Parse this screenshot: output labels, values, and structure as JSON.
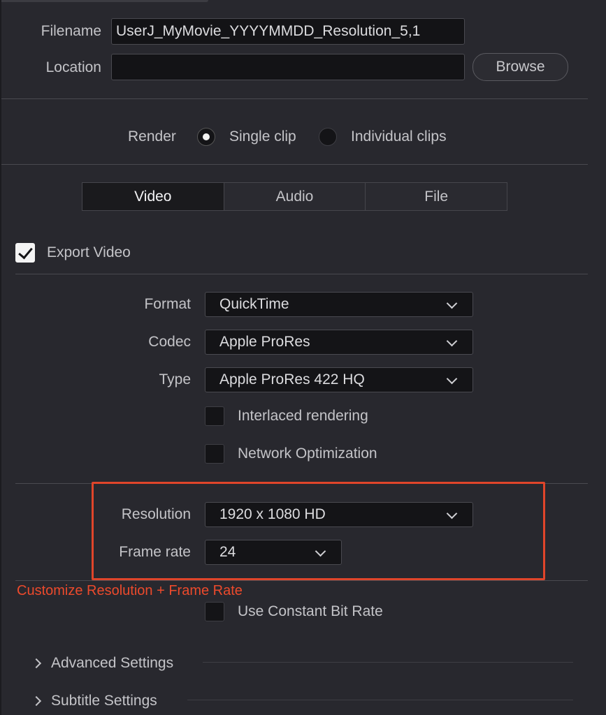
{
  "file": {
    "filename_label": "Filename",
    "filename_value": "UserJ_MyMovie_YYYYMMDD_Resolution_5,1",
    "location_label": "Location",
    "location_value": "",
    "browse_label": "Browse"
  },
  "render": {
    "label": "Render",
    "single_clip": "Single clip",
    "individual_clips": "Individual clips",
    "selected": "single_clip"
  },
  "tabs": [
    {
      "label": "Video",
      "active": true
    },
    {
      "label": "Audio",
      "active": false
    },
    {
      "label": "File",
      "active": false
    }
  ],
  "video": {
    "export_video_label": "Export Video",
    "export_video_checked": true,
    "format_label": "Format",
    "format_value": "QuickTime",
    "codec_label": "Codec",
    "codec_value": "Apple ProRes",
    "type_label": "Type",
    "type_value": "Apple ProRes 422 HQ",
    "interlaced_label": "Interlaced rendering",
    "interlaced_checked": false,
    "network_label": "Network Optimization",
    "network_checked": false,
    "resolution_label": "Resolution",
    "resolution_value": "1920 x 1080 HD",
    "framerate_label": "Frame rate",
    "framerate_value": "24",
    "cbr_label": "Use Constant Bit Rate",
    "cbr_checked": false
  },
  "annotation": {
    "text": "Customize Resolution + Frame Rate",
    "color": "#e0452a"
  },
  "sections": {
    "advanced": "Advanced Settings",
    "subtitle": "Subtitle Settings"
  },
  "icons": {
    "dropdown": "chevron-down-icon",
    "disclosure": "chevron-right-icon",
    "check": "checkmark-icon"
  }
}
